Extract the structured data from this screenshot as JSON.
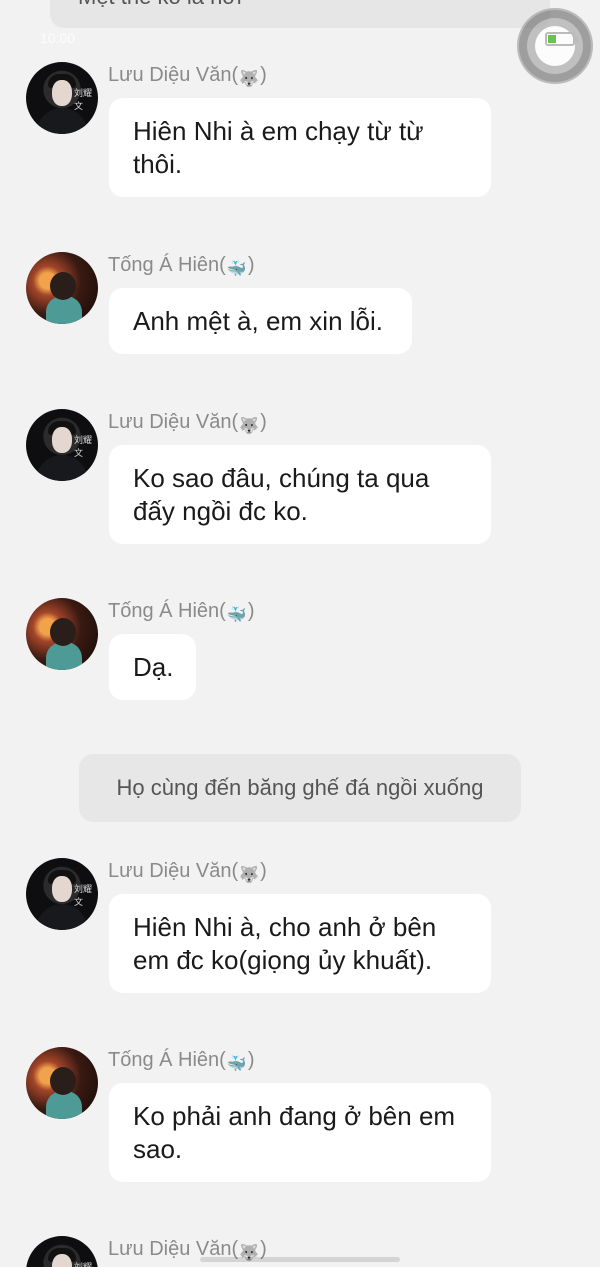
{
  "top_narration": "Mệt thế ko lá hơi",
  "status_bar": {
    "time": "10:00"
  },
  "messages": [
    {
      "sender": "Lưu Diệu Văn(",
      "sender_end": ")",
      "emoji": "wolf",
      "text": "Hiên Nhi à em chạy từ từ thôi."
    },
    {
      "sender": "Tống Á Hiên(",
      "sender_end": ")",
      "emoji": "whale",
      "text": "Anh mệt à, em xin lỗi."
    },
    {
      "sender": "Lưu Diệu Văn(",
      "sender_end": ")",
      "emoji": "wolf",
      "text": "Ko sao đâu, chúng ta qua đấy ngồi đc ko."
    },
    {
      "sender": "Tống Á Hiên(",
      "sender_end": ")",
      "emoji": "whale",
      "text": "Dạ."
    },
    {
      "sender": "Lưu Diệu Văn(",
      "sender_end": ")",
      "emoji": "wolf",
      "text": "Hiên Nhi à, cho anh ở bên em đc ko(giọng ủy khuất)."
    },
    {
      "sender": "Tống Á Hiên(",
      "sender_end": ")",
      "emoji": "whale",
      "text": "Ko phải anh đang ở bên em sao."
    },
    {
      "sender": "Lưu Diệu Văn(",
      "sender_end": ")",
      "emoji": "wolf",
      "text": ""
    }
  ],
  "narration": "Họ cùng đến băng ghế đá ngồi xuống",
  "avatar_tag": "刘耀文",
  "colors": {
    "background": "#f2f2f2",
    "bubble": "#ffffff",
    "narration_bg": "#e7e7e7",
    "sender_text": "#8a8a8a",
    "message_text": "#1a1a1a"
  }
}
